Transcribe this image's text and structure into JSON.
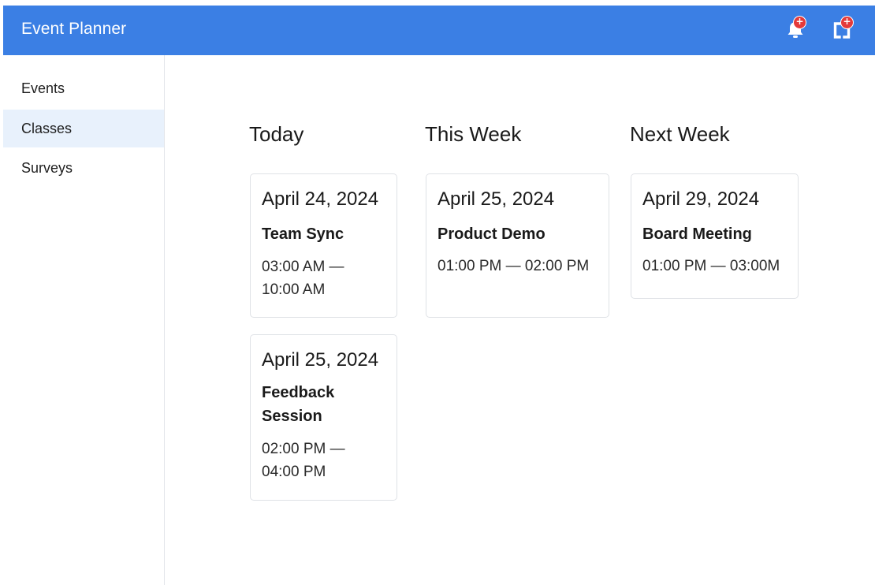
{
  "header": {
    "title": "Event Planner",
    "notifications_badge": "+",
    "logout_badge": "+",
    "accent_color": "#3b7fe4",
    "badge_color": "#e43a3a"
  },
  "sidebar": {
    "items": [
      {
        "label": "Events",
        "selected": false
      },
      {
        "label": "Classes",
        "selected": true
      },
      {
        "label": "Surveys",
        "selected": false
      }
    ]
  },
  "columns": [
    {
      "heading": "Today",
      "cards": [
        {
          "date": "April 24, 2024",
          "title": "Team Sync",
          "time": "03:00 AM — 10:00 AM"
        },
        {
          "date": "April 25, 2024",
          "title": "Feedback Session",
          "time": "02:00 PM — 04:00 PM"
        }
      ]
    },
    {
      "heading": "This Week",
      "cards": [
        {
          "date": "April 25, 2024",
          "title": "Product Demo",
          "time": "01:00 PM — 02:00 PM"
        }
      ]
    },
    {
      "heading": "Next Week",
      "cards": [
        {
          "date": "April 29, 2024",
          "title": "Board Meeting",
          "time": "01:00 PM — 03:00M"
        }
      ]
    }
  ]
}
